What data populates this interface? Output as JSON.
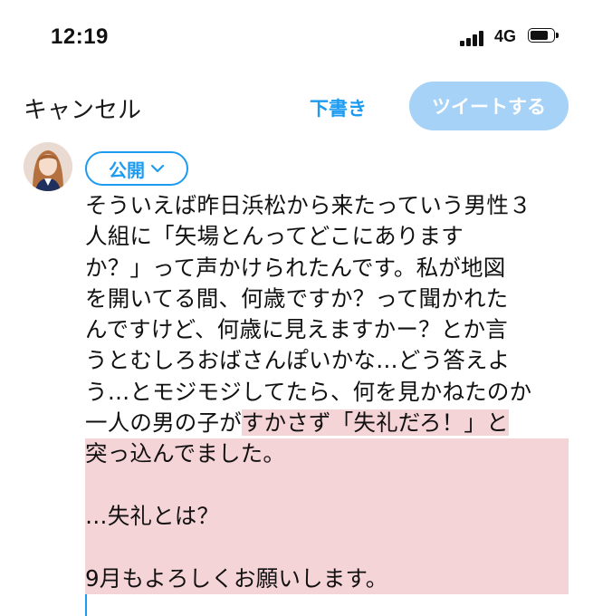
{
  "status_bar": {
    "time": "12:19",
    "network": "4G"
  },
  "header": {
    "cancel_label": "キャンセル",
    "draft_label": "下書き",
    "tweet_label": "ツイートする"
  },
  "audience": {
    "label": "公開"
  },
  "tweet": {
    "lines": [
      "そういえば昨日浜松から来たっていう男性３",
      "人組に「矢場とんってどこにありますか？」",
      "か？」って声かけられたんです。私が地図",
      "を開いてる間、何歳ですか？って聞かれた",
      "んですけど、何歳に見えますかー？とか言",
      "うとむしろおばさんぽいかな…どう答えよ",
      "う…とモジモジしてたら、何を見かねたのか"
    ],
    "line2": "人組に「矢場とんってどこにあります",
    "line8_plain": "一人の男の子が",
    "line8_selected": "すかさず「失礼だろ！」と",
    "line9_selected": "突っ込んでました。",
    "line11_selected": "…失礼とは？",
    "line13_selected": "9月もよろしくお願いします。"
  },
  "colors": {
    "accent": "#1d9bf0",
    "tweet_button_disabled": "#a5d2f6",
    "selection": "#f5d4d8"
  },
  "icons": {
    "audience_chevron": "chevron-down-icon",
    "battery": "battery-icon",
    "signal": "signal-icon"
  }
}
